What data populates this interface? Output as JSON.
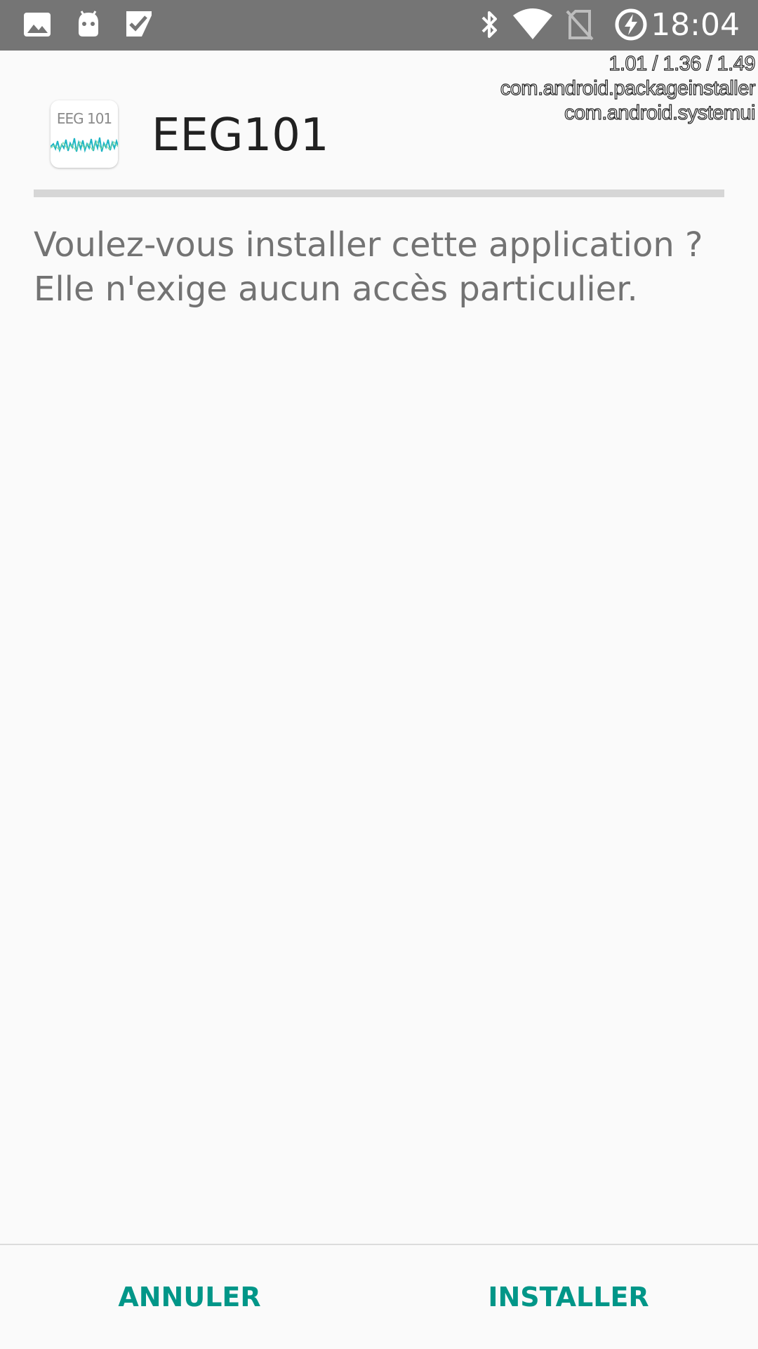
{
  "status_bar": {
    "time": "18:04",
    "left_icons": [
      "gallery-icon",
      "android-bot-icon",
      "task-check-icon"
    ],
    "right_icons": [
      "bluetooth-icon",
      "wifi-icon",
      "no-sim-icon",
      "battery-charging-icon"
    ],
    "background": "#757575"
  },
  "debug_overlay": {
    "line1": "1.01 / 1.36 / 1.49",
    "line2": "com.android.packageinstaller",
    "line3": "com.android.systemui"
  },
  "app": {
    "icon_label": "EEG 101",
    "name": "EEG101"
  },
  "message": {
    "line1": "Voulez-vous installer cette application ?",
    "line2": "Elle n'exige aucun accès particulier."
  },
  "buttons": {
    "cancel": "ANNULER",
    "install": "INSTALLER"
  },
  "colors": {
    "accent": "#009688",
    "background": "#fafafa"
  }
}
